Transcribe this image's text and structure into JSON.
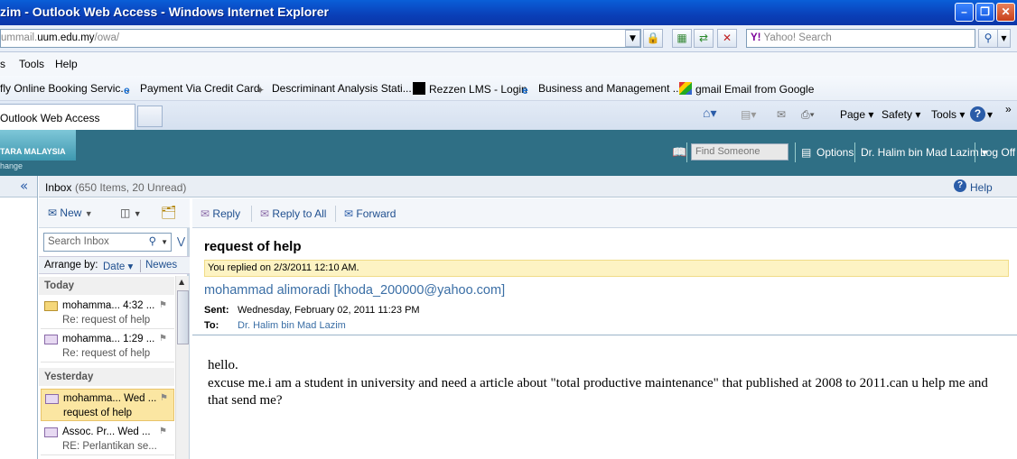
{
  "window": {
    "title": "zim - Outlook Web Access - Windows Internet Explorer"
  },
  "address": {
    "prefix": "ummail.",
    "domain": "uum.edu.my",
    "path": "/owa/"
  },
  "search": {
    "engine": "Y!",
    "placeholder": "Yahoo! Search"
  },
  "menu": [
    "s",
    "Tools",
    "Help"
  ],
  "favorites": [
    {
      "label": "fly Online Booking Servic...",
      "icon": "page-icon"
    },
    {
      "label": "Payment Via Credit Card",
      "icon": "ie-icon"
    },
    {
      "label": "Descriminant Analysis  Stati...",
      "icon": "satellite-icon"
    },
    {
      "label": "Rezzen LMS - Login",
      "icon": "black-square-icon"
    },
    {
      "label": "Business and Management ...",
      "icon": "ie-icon"
    },
    {
      "label": "gmail Email from Google",
      "icon": "google-icon"
    }
  ],
  "tabs": {
    "active": "Outlook Web Access"
  },
  "commands": {
    "page": "Page",
    "safety": "Safety",
    "tools": "Tools"
  },
  "owa": {
    "logo": "TARA MALAYSIA",
    "logo_sub": "hange",
    "find_placeholder": "Find Someone",
    "options": "Options",
    "user": "Dr. Halim bin Mad Lazim",
    "logoff": "Log Off"
  },
  "folder": {
    "name": "Inbox",
    "counts": "(650 Items, 20 Unread)",
    "help": "Help"
  },
  "list": {
    "new_label": "New",
    "search_placeholder": "Search Inbox",
    "arrange_label": "Arrange by:",
    "arrange_value": "Date",
    "sort_label": "Newes",
    "groups": [
      {
        "label": "Today",
        "messages": [
          {
            "from": "mohamma...",
            "time": "4:32 ...",
            "subject": "Re: request of help"
          },
          {
            "from": "mohamma...",
            "time": "1:29 ...",
            "subject": "Re: request of help"
          }
        ]
      },
      {
        "label": "Yesterday",
        "messages": [
          {
            "from": "mohamma...",
            "time": "Wed ...",
            "subject": "request of help"
          },
          {
            "from": "Assoc. Pr...",
            "time": "Wed ...",
            "subject": "RE: Perlantikan se..."
          }
        ]
      }
    ]
  },
  "reading": {
    "actions": {
      "reply": "Reply",
      "reply_all": "Reply to All",
      "forward": "Forward"
    },
    "subject": "request of help",
    "replied_notice": "You replied on 2/3/2011 12:10 AM.",
    "from": "mohammad alimoradi [khoda_200000@yahoo.com]",
    "sent_label": "Sent:",
    "sent_value": "Wednesday, February 02, 2011 11:23 PM",
    "to_label": "To:",
    "to_value": "Dr. Halim bin Mad Lazim",
    "body_line1": "hello.",
    "body_line2": "excuse me.i am a student in university and need a article about \"total productive maintenance\" that published at 2008 to 2011.can u help me and that send me?"
  }
}
